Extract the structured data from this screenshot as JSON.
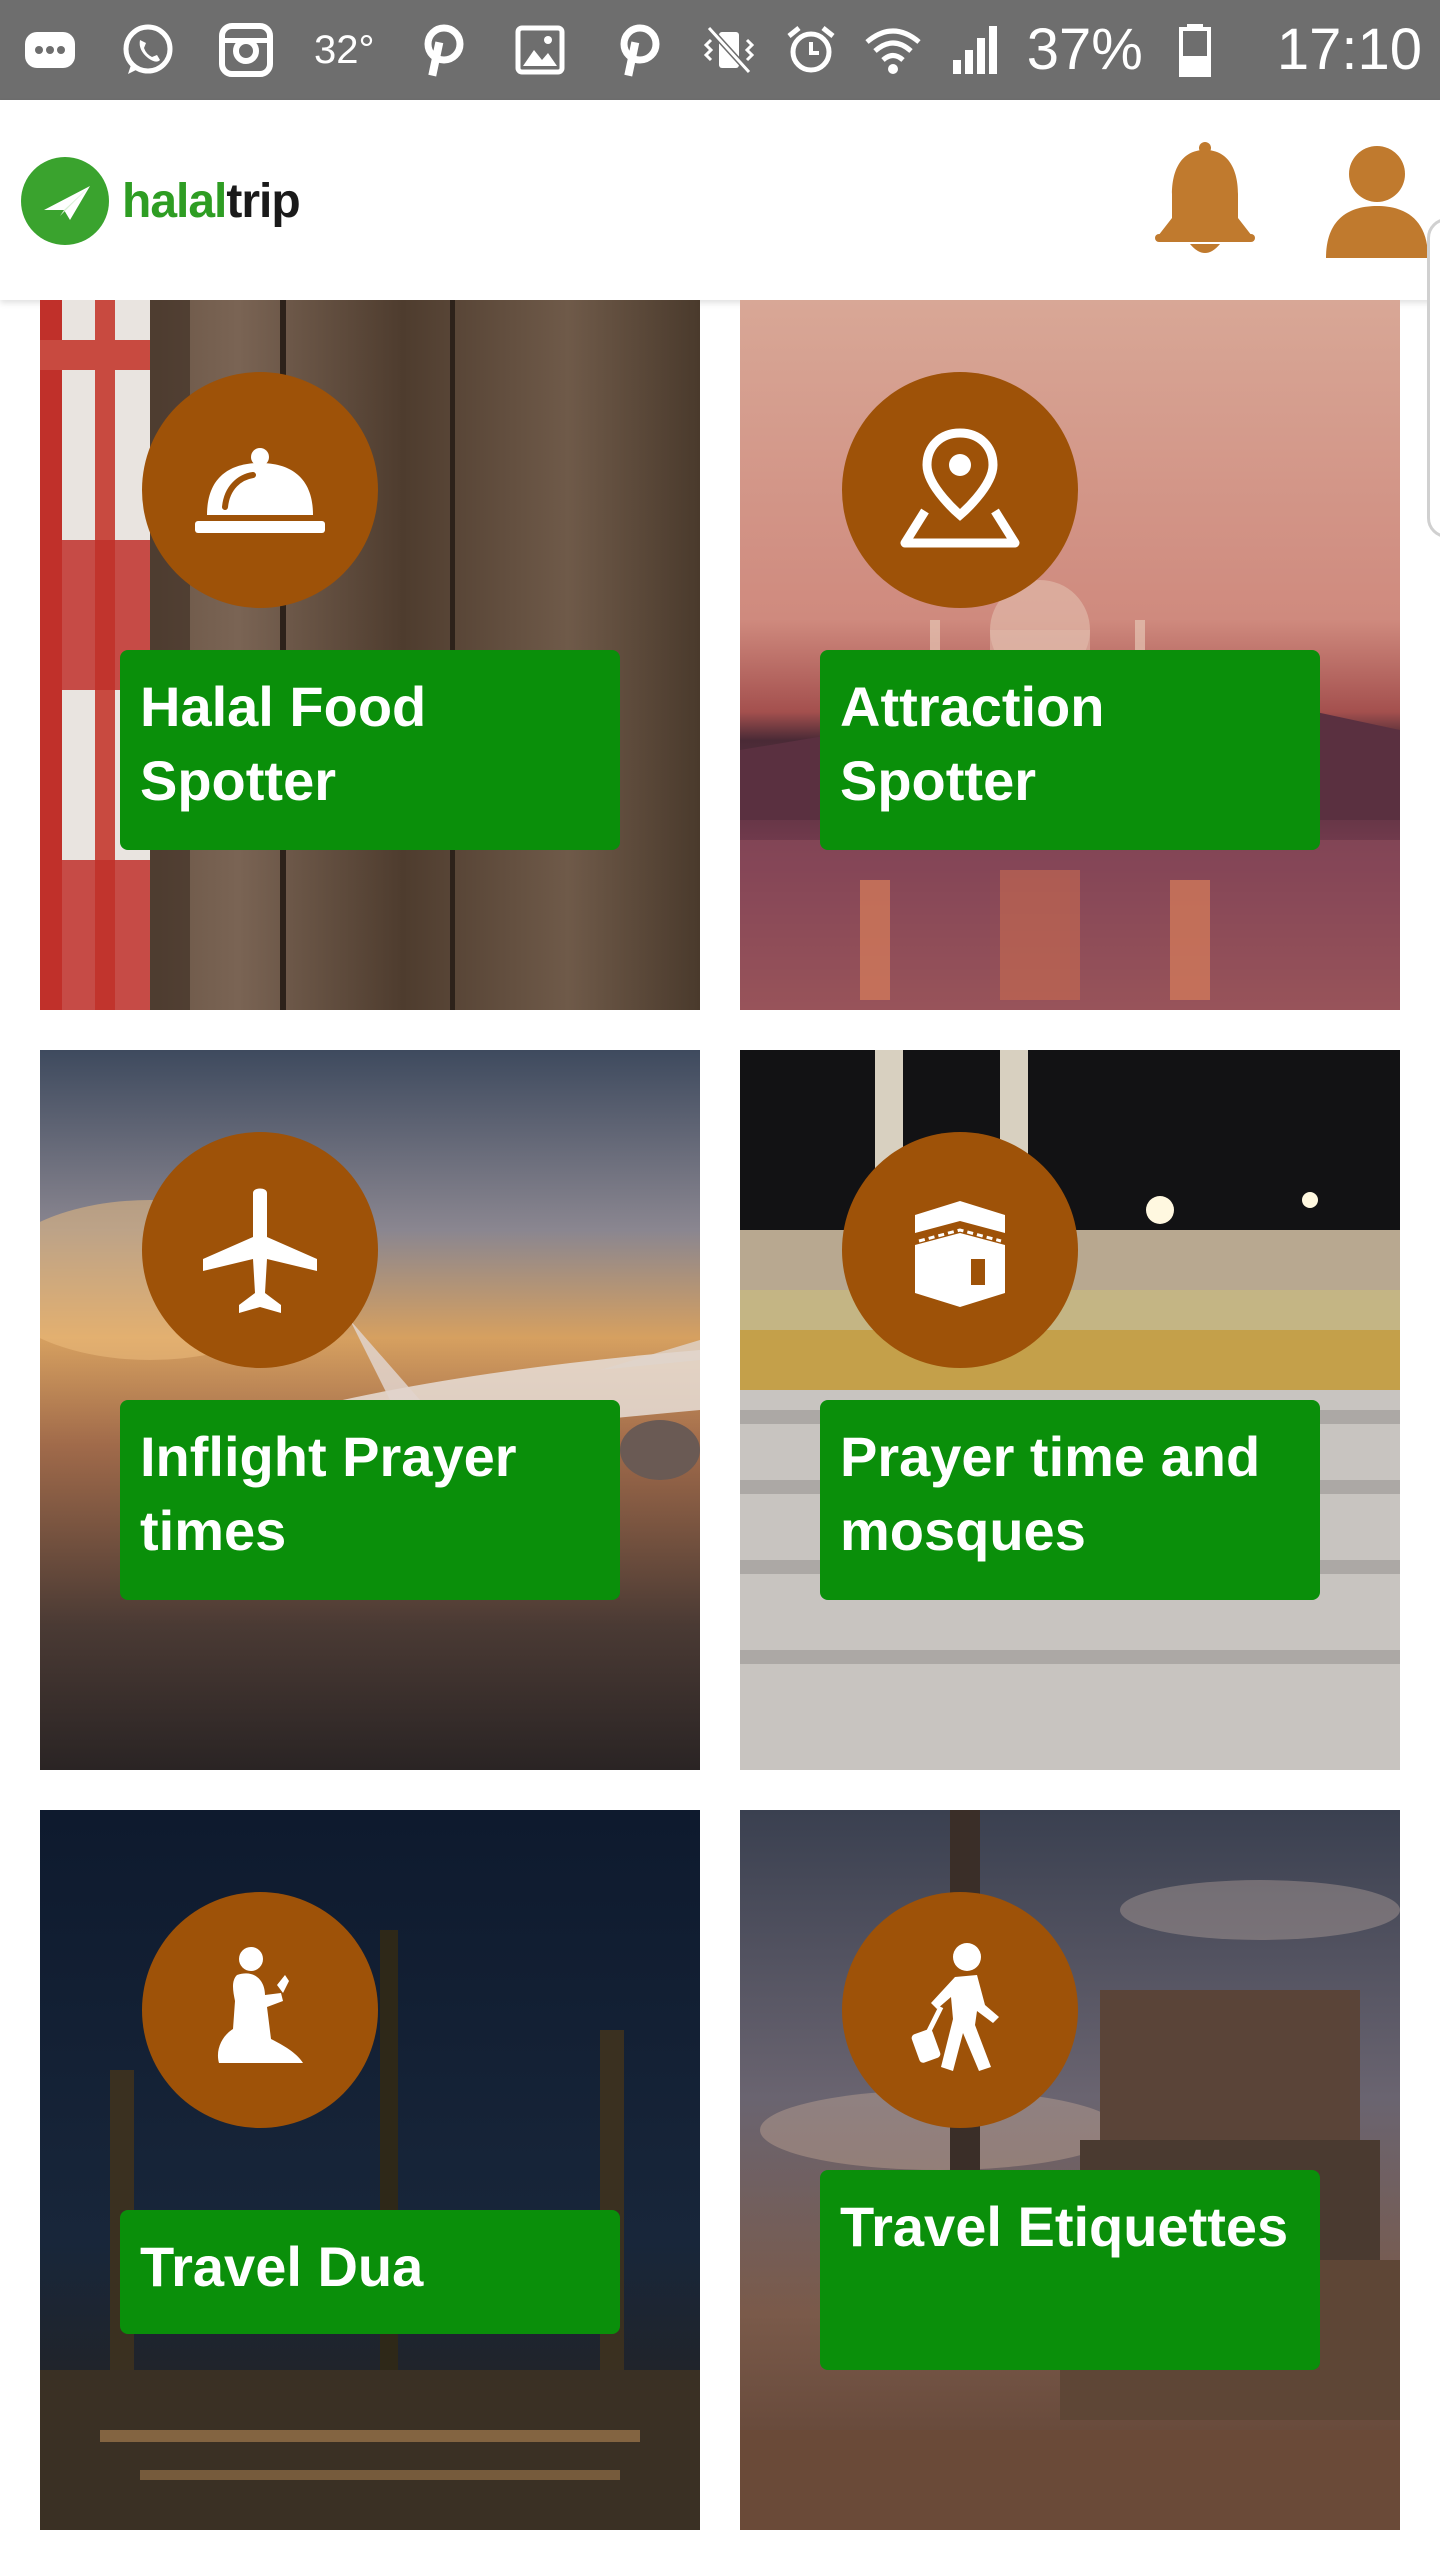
{
  "status_bar": {
    "temperature": "32°",
    "battery_percent": "37%",
    "clock": "17:10"
  },
  "header": {
    "brand_part1": "halal",
    "brand_part2": "trip",
    "icons": {
      "notifications": "bell-icon",
      "account": "user-icon"
    }
  },
  "tiles": [
    {
      "label": "Halal Food Spotter",
      "icon": "food-cloche-icon"
    },
    {
      "label": "Attraction Spotter",
      "icon": "map-pin-icon"
    },
    {
      "label": "Inflight Prayer times",
      "icon": "airplane-icon"
    },
    {
      "label": "Prayer time and mosques",
      "icon": "kaaba-icon"
    },
    {
      "label": "Travel Dua",
      "icon": "praying-person-icon"
    },
    {
      "label": "Travel Etiquettes",
      "icon": "traveler-icon"
    }
  ],
  "colors": {
    "status_bar": "#6e6e6e",
    "brand_green": "#2e9d23",
    "label_green": "#0a8f0a",
    "icon_circle_brown": "#9e5208",
    "header_icon_gold": "#c07a2e"
  }
}
